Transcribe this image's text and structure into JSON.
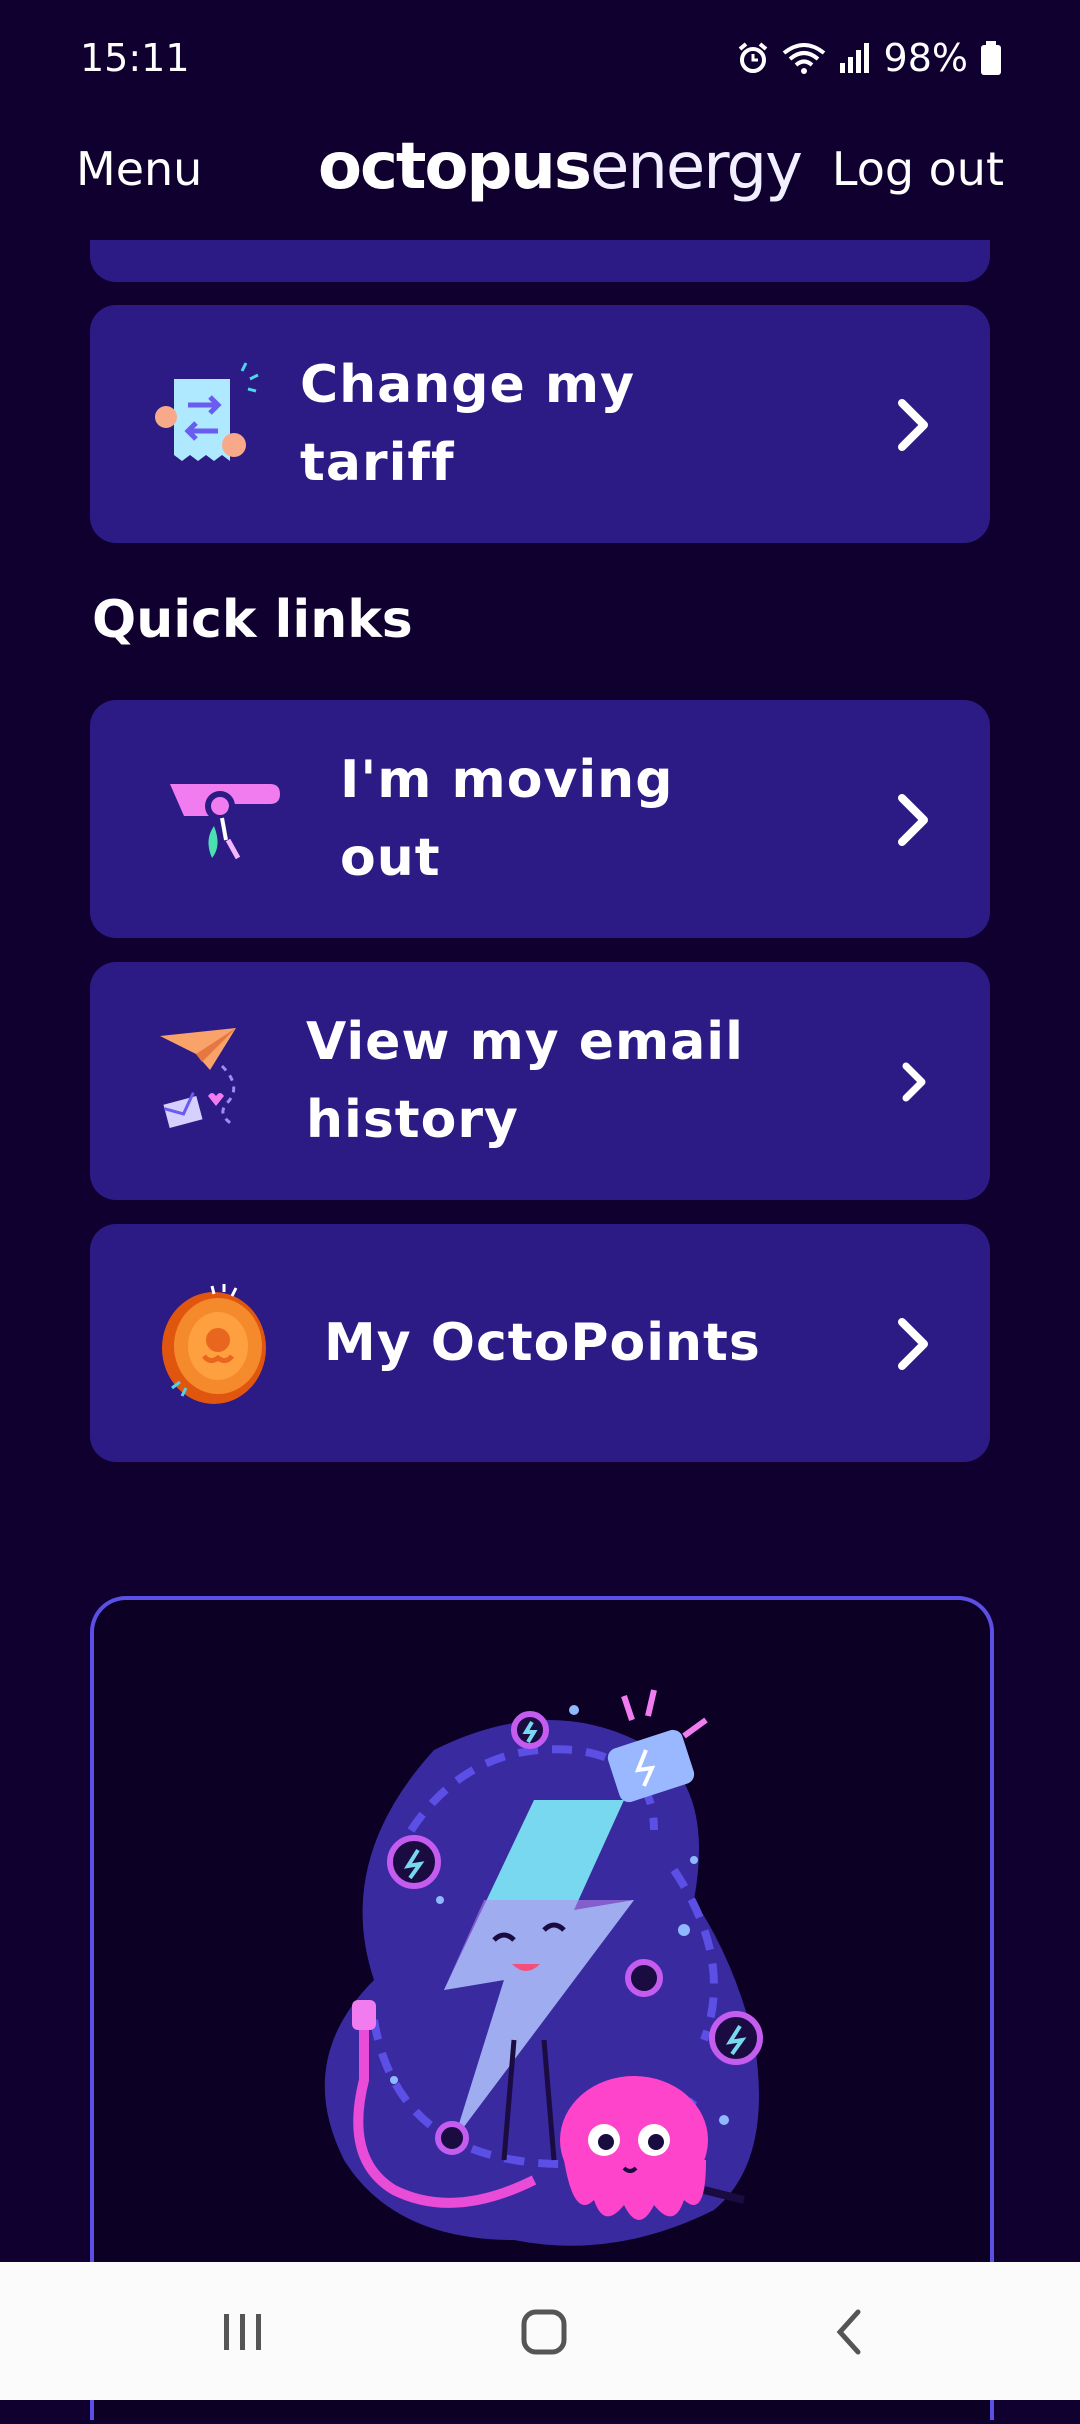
{
  "status": {
    "time": "15:11",
    "battery": "98%"
  },
  "header": {
    "menu": "Menu",
    "logo_bold": "octopus",
    "logo_light": "energy",
    "logout": "Log out"
  },
  "cards": [
    {
      "line1": "Change my",
      "line2": "tariff",
      "icon": "tariff-swap-icon"
    }
  ],
  "quick_links": {
    "title": "Quick links",
    "items": [
      {
        "line1": "I'm moving",
        "line2": "out",
        "icon": "keys-hand-icon"
      },
      {
        "line1": "View my email",
        "line2": "history",
        "icon": "paper-plane-icon"
      },
      {
        "line1": "My OctoPoints",
        "icon": "octopoints-coin-icon"
      }
    ]
  },
  "colors": {
    "background": "#100030",
    "card": "#2c1a85",
    "promo_border": "#5b4fe6",
    "navbar": "#fbfbfb"
  }
}
